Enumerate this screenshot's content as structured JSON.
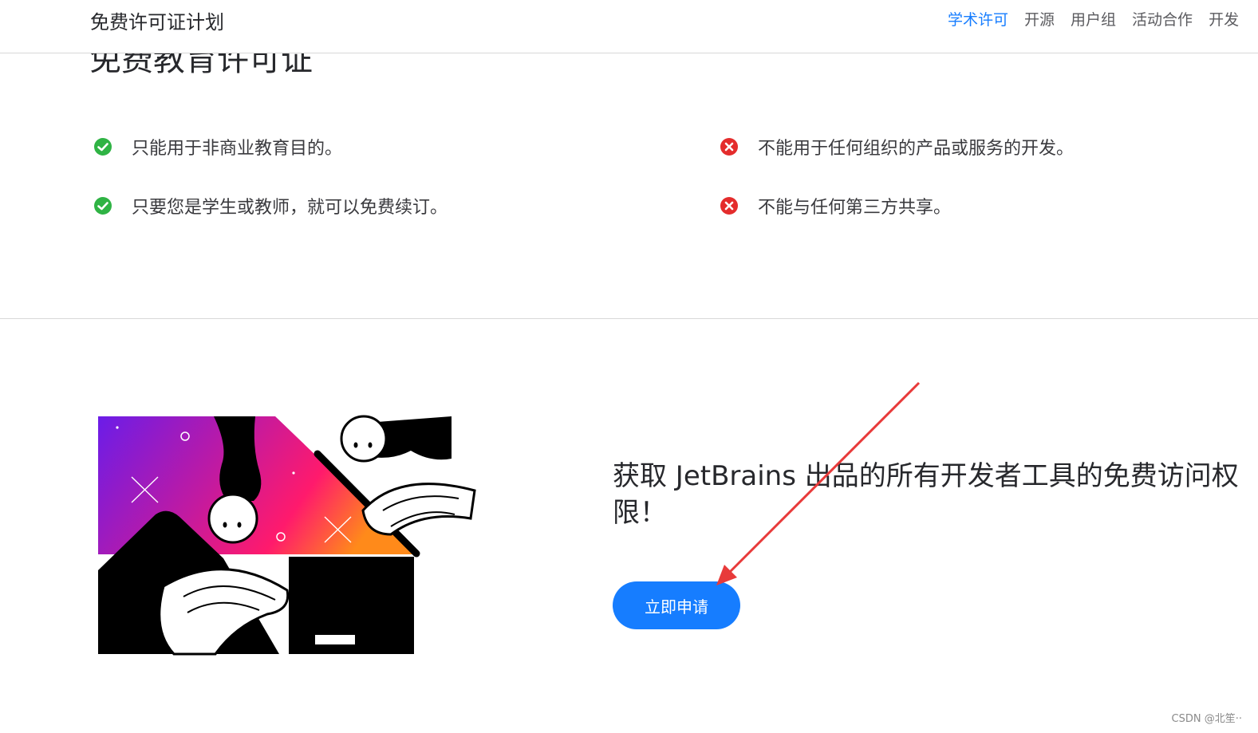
{
  "header": {
    "brand": "免费许可证计划",
    "nav": [
      "学术许可",
      "开源",
      "用户组",
      "活动合作",
      "开发"
    ],
    "active_index": 0
  },
  "main": {
    "heading": "免费教育许可证",
    "allowed": [
      "只能用于非商业教育目的。",
      "只要您是学生或教师，就可以免费续订。"
    ],
    "disallowed": [
      "不能用于任何组织的产品或服务的开发。",
      "不能与任何第三方共享。"
    ]
  },
  "promo": {
    "line1": "获取 JetBrains 出品的所有开发者工具的免费访问权",
    "line2": "限！",
    "button": "立即申请"
  },
  "icons": {
    "check": "check-circle-icon",
    "cross": "x-circle-icon"
  },
  "colors": {
    "accent": "#167dff",
    "check": "#2fb344",
    "cross": "#e42c2c",
    "annotation": "#e83a3a"
  },
  "watermark": "CSDN @北笙··"
}
